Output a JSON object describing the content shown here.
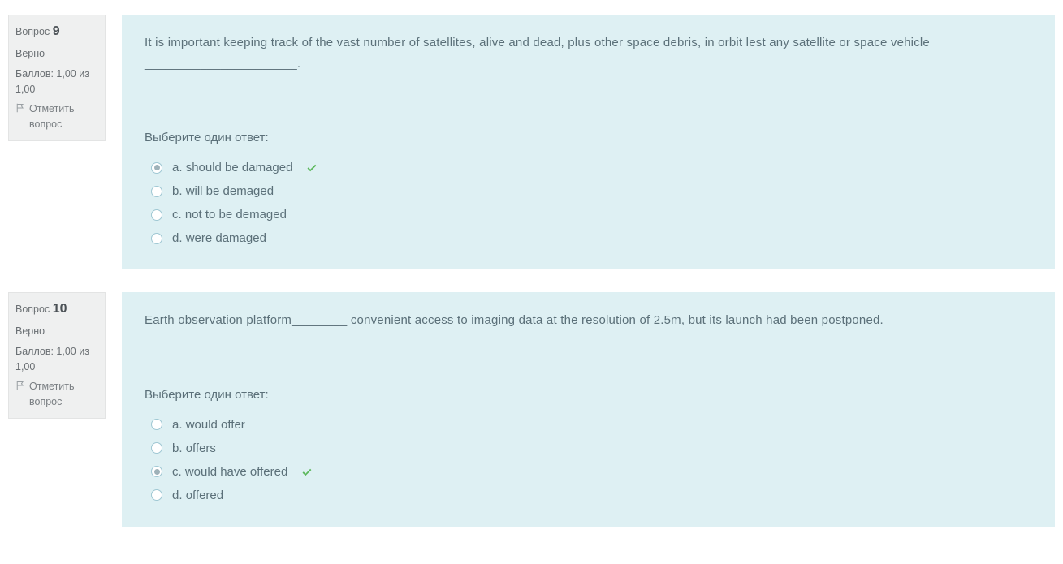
{
  "labels": {
    "question_word": "Вопрос",
    "flag_text": "Отметить вопрос",
    "choose_prompt": "Выберите один ответ:"
  },
  "questions": [
    {
      "number": "9",
      "status": "Верно",
      "score": "Баллов: 1,00 из 1,00",
      "text": "It is important keeping track of the vast number of satellites, alive and dead, plus other space debris, in orbit lest any satellite or space vehicle ______________________.",
      "options": [
        {
          "letter": "a.",
          "text": "should be damaged",
          "selected": true,
          "correct": true
        },
        {
          "letter": "b.",
          "text": "will be demaged",
          "selected": false,
          "correct": false
        },
        {
          "letter": "c.",
          "text": "not to be demaged",
          "selected": false,
          "correct": false
        },
        {
          "letter": "d.",
          "text": "were damaged",
          "selected": false,
          "correct": false
        }
      ]
    },
    {
      "number": "10",
      "status": "Верно",
      "score": "Баллов: 1,00 из 1,00",
      "text": "Earth observation platform________ convenient access to imaging data at the resolution of 2.5m, but its launch had been postponed.",
      "options": [
        {
          "letter": "a.",
          "text": "would offer",
          "selected": false,
          "correct": false
        },
        {
          "letter": "b.",
          "text": "offers",
          "selected": false,
          "correct": false
        },
        {
          "letter": "c.",
          "text": "would have offered",
          "selected": true,
          "correct": true
        },
        {
          "letter": "d.",
          "text": "offered",
          "selected": false,
          "correct": false
        }
      ]
    }
  ]
}
